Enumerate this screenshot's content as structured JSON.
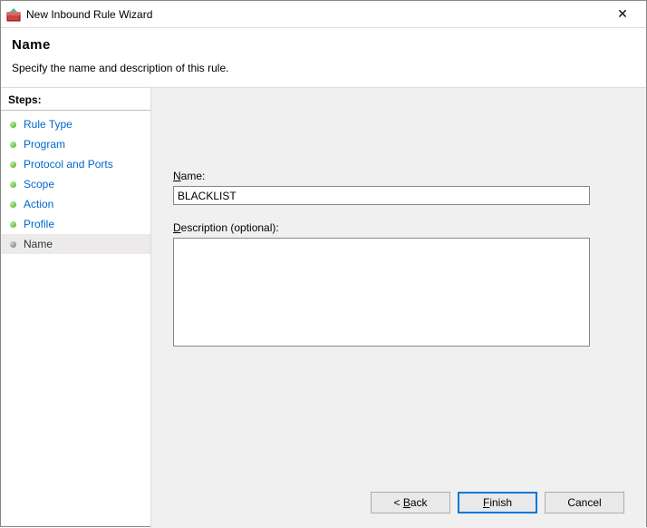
{
  "window": {
    "title": "New Inbound Rule Wizard"
  },
  "header": {
    "page_title": "Name",
    "subtitle": "Specify the name and description of this rule."
  },
  "sidebar": {
    "heading": "Steps:",
    "items": [
      {
        "label": "Rule Type"
      },
      {
        "label": "Program"
      },
      {
        "label": "Protocol and Ports"
      },
      {
        "label": "Scope"
      },
      {
        "label": "Action"
      },
      {
        "label": "Profile"
      },
      {
        "label": "Name"
      }
    ],
    "current_index": 6
  },
  "form": {
    "name_label": "Name:",
    "name_value": "BLACKLIST",
    "desc_label": "Description (optional):",
    "desc_value": ""
  },
  "buttons": {
    "back": "< Back",
    "finish": "Finish",
    "cancel": "Cancel"
  }
}
